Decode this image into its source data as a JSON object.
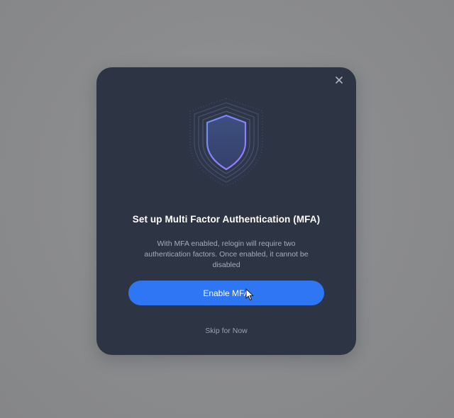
{
  "dialog": {
    "title": "Set up Multi Factor Authentication (MFA)",
    "description": "With MFA enabled, relogin will require two authentication factors. Once enabled, it cannot be disabled",
    "primary_button_label": "Enable MFA",
    "skip_label": "Skip for Now",
    "icons": {
      "close": "close-icon",
      "hero": "shield-icon",
      "cursor": "mouse-pointer-icon"
    }
  },
  "colors": {
    "overlay": "#8a8b8d",
    "modal_background": "#2d3444",
    "accent": "#2f76f5",
    "title_text": "#ffffff",
    "muted_text": "#a5acb9"
  }
}
